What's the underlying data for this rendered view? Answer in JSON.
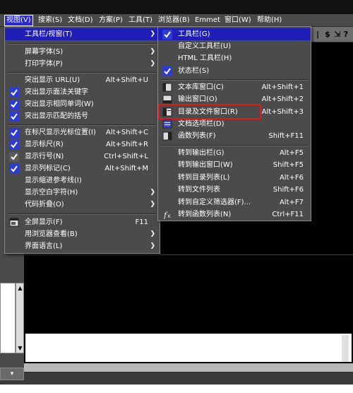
{
  "menubar": {
    "items": [
      {
        "label": "视图(V)",
        "active": true
      },
      {
        "label": "搜索(S)"
      },
      {
        "label": "文档(D)"
      },
      {
        "label": "方案(P)"
      },
      {
        "label": "工具(T)"
      },
      {
        "label": "浏览器(B)"
      },
      {
        "label": "Emmet"
      },
      {
        "label": "窗口(W)"
      },
      {
        "label": "帮助(H)"
      }
    ]
  },
  "view_menu": {
    "items": [
      {
        "label": "工具栏/视窗(T)",
        "submenu": true,
        "highlighted": true
      },
      {
        "label": "屏幕字体(S)",
        "submenu": true
      },
      {
        "label": "打印字体(P)",
        "submenu": true
      },
      {
        "label": "突出显示 URL(U)",
        "shortcut": "Alt+Shift+U"
      },
      {
        "label": "突出显示面法关键字",
        "checked": true
      },
      {
        "label": "突出显示相同单词(W)",
        "checked": true
      },
      {
        "label": "突出显示匹配的括号",
        "checked": true
      },
      {
        "label": "在标尺显示光标位置(I)",
        "shortcut": "Alt+Shift+C",
        "checked": true
      },
      {
        "label": "显示标尺(R)",
        "shortcut": "Alt+Shift+R",
        "checked": true
      },
      {
        "label": "显示行号(N)",
        "shortcut": "Ctrl+Shift+L",
        "checked": true
      },
      {
        "label": "显示列标记(C)",
        "shortcut": "Alt+Shift+M",
        "checked": true
      },
      {
        "label": "显示缩进参考线(I)"
      },
      {
        "label": "显示空白字符(H)",
        "submenu": true
      },
      {
        "label": "代码折叠(O)",
        "submenu": true
      },
      {
        "label": "全屏显示(F)",
        "shortcut": "F11",
        "icon": "fullscreen-icon"
      },
      {
        "label": "用浏览器查看(B)",
        "submenu": true
      },
      {
        "label": "界面语言(L)",
        "submenu": true
      }
    ]
  },
  "toolbar_menu": {
    "items": [
      {
        "label": "工具栏(G)",
        "checked": true,
        "highlighted": true
      },
      {
        "label": "自定义工具栏(U)"
      },
      {
        "label": "HTML 工具栏(H)"
      },
      {
        "label": "状态栏(S)",
        "checked": true
      },
      {
        "label": "文本库窗口(C)",
        "shortcut": "Alt+Shift+1",
        "icon": "text-library-icon"
      },
      {
        "label": "输出窗口(O)",
        "shortcut": "Alt+Shift+2",
        "icon": "output-window-icon"
      },
      {
        "label": "目录及文件窗口(R)",
        "shortcut": "Alt+Shift+3",
        "icon": "directory-window-icon"
      },
      {
        "label": "文档选项栏(D)",
        "icon": "document-tabs-icon"
      },
      {
        "label": "函数列表(F)",
        "shortcut": "Shift+F11",
        "icon": "function-list-icon"
      },
      {
        "label": "转到输出栏(G)",
        "shortcut": "Alt+F5"
      },
      {
        "label": "转到输出窗口(W)",
        "shortcut": "Shift+F5"
      },
      {
        "label": "转到目录列表(L)",
        "shortcut": "Alt+F6"
      },
      {
        "label": "转到文件列表",
        "shortcut": "Shift+F6"
      },
      {
        "label": "转到自定义筛选器(F)...",
        "shortcut": "Alt+F7"
      },
      {
        "label": "转到函数列表(N)",
        "shortcut": "Ctrl+F11",
        "icon": "function-goto-icon"
      }
    ]
  },
  "colors": {
    "menu_bg": "#4b4b4b",
    "highlight": "#1f1fb8",
    "check_bg": "#2d3bd6",
    "annotation_box": "#e01818"
  }
}
